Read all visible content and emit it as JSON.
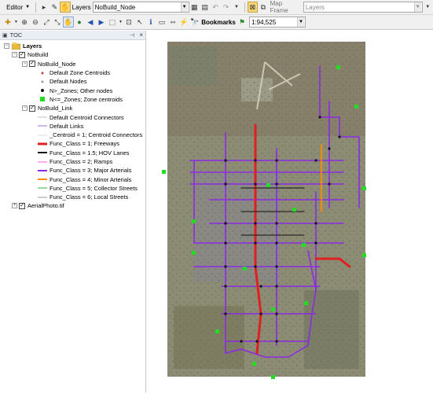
{
  "toolbar": {
    "editor_label": "Editor",
    "layers_label": "Layers",
    "layer_value": "NoBuild_Node",
    "map_frame_label": "Map Frame",
    "map_frame_value": "Layers",
    "bookmarks_label": "Bookmarks",
    "scale_value": "1:94,525"
  },
  "toc": {
    "title": "TOC",
    "root": "Layers",
    "groups": {
      "nobuild": "NoBuild",
      "node_layer": "NoBuild_Node",
      "link_layer": "NoBuild_Link",
      "aerial": "AerialPhoto.tif"
    },
    "node_items": [
      {
        "label": "Default Zone Centroids",
        "color": "#c04040"
      },
      {
        "label": "Default Nodes",
        "color": "#999999"
      },
      {
        "label": "N>_Zones; Other nodes",
        "color": "#111111"
      },
      {
        "label": "N<=_Zones; Zone centroids",
        "color": "#22dd22"
      }
    ],
    "link_items": [
      {
        "label": "Default Centroid Connectors",
        "color": "#c0c0c0",
        "w": 1
      },
      {
        "label": "Default Links",
        "color": "#9a6fd0",
        "w": 1
      },
      {
        "label": "_Centroid = 1; Centroid Connectors",
        "color": "#dddddd",
        "w": 1
      },
      {
        "label": "Func_Class = 1; Freeways",
        "color": "#e02020",
        "w": 3
      },
      {
        "label": "Func_Class = 1.5; HOV Lanes",
        "color": "#111111",
        "w": 2
      },
      {
        "label": "Func_Class = 2; Ramps",
        "color": "#ff60d0",
        "w": 1
      },
      {
        "label": "Func_Class = 3; Major Arterials",
        "color": "#8a2be2",
        "w": 2
      },
      {
        "label": "Func_Class = 4; Minor Arterials",
        "color": "#ff8c00",
        "w": 2
      },
      {
        "label": "Func_Class = 5; Collector Streets",
        "color": "#30b030",
        "w": 1
      },
      {
        "label": "Func_Class = 6; Local Streets",
        "color": "#9a9a9a",
        "w": 1
      }
    ]
  }
}
